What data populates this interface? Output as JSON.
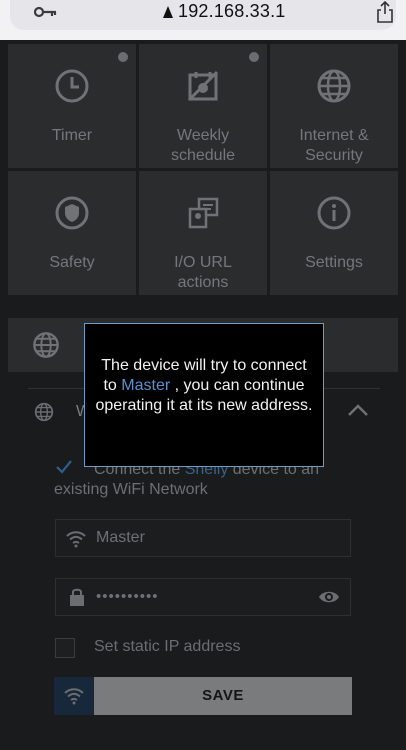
{
  "browser": {
    "url": "192.168.33.1",
    "icons": [
      "key-icon",
      "lock-icon",
      "share-icon"
    ]
  },
  "tiles": [
    {
      "label": "Timer",
      "icon": "clock-icon",
      "has_dot": true
    },
    {
      "label": "Weekly schedule",
      "icon": "calendar-off-icon",
      "has_dot": true
    },
    {
      "label": "Internet & Security",
      "icon": "globe-icon",
      "has_dot": false
    },
    {
      "label": "Safety",
      "icon": "shield-icon",
      "has_dot": false
    },
    {
      "label": "I/O URL actions",
      "icon": "url-actions-icon",
      "has_dot": false
    },
    {
      "label": "Settings",
      "icon": "info-icon",
      "has_dot": false
    }
  ],
  "wifi_section": {
    "label": "W",
    "checkbox_checked": true,
    "connect_text_pre": "Connect the ",
    "connect_brand": "Shelly",
    "connect_text_post": " device to an existing WiFi Network",
    "ssid_value": "Master",
    "password_value": "••••••••••",
    "static_ip_label": "Set static IP address",
    "static_ip_checked": false,
    "save_label": "SAVE"
  },
  "modal": {
    "text_pre": "The device will try to connect to ",
    "ssid": "Master",
    "text_post": " , you can continue operating it at its new address."
  },
  "colors": {
    "background": "#191b1d",
    "tile": "#2a2c2e",
    "accent": "#5b8fd0",
    "modal_border": "#6e9cc4"
  }
}
